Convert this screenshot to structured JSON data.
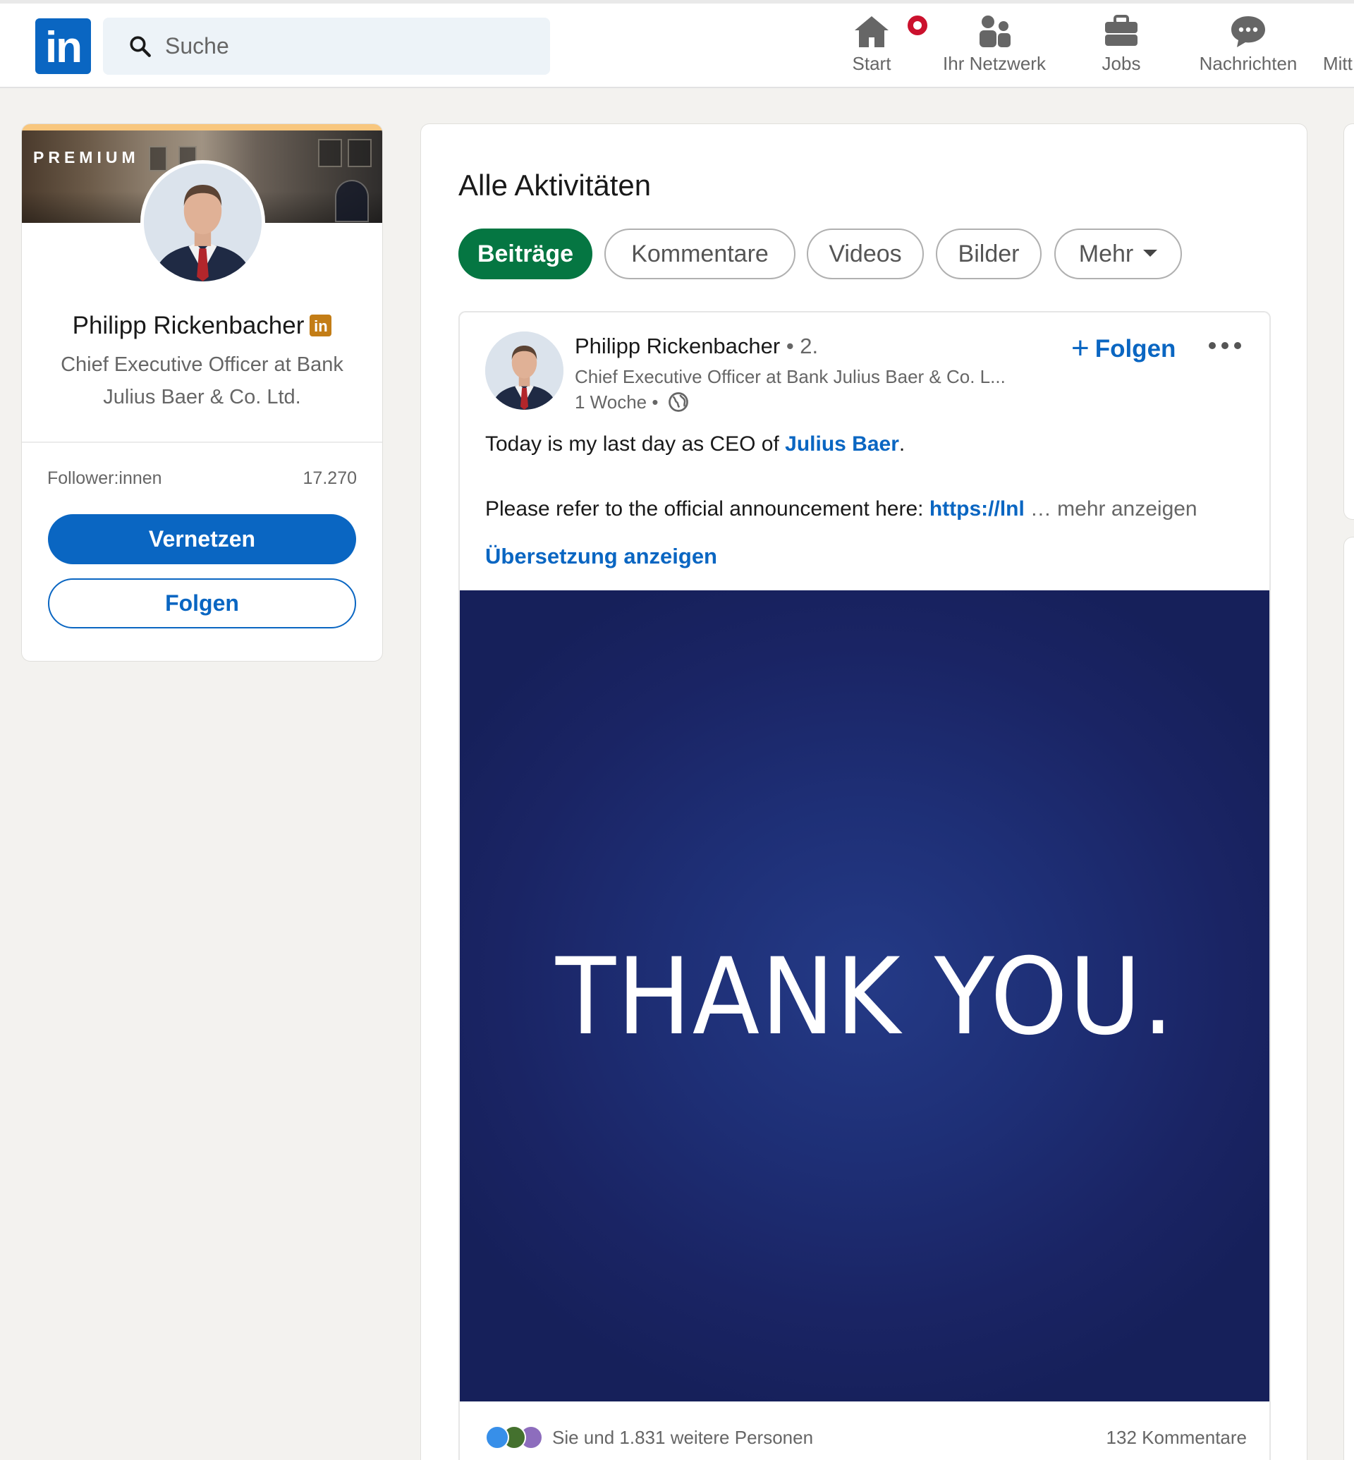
{
  "nav": {
    "logo_text": "in",
    "search_placeholder": "Suche",
    "items": [
      {
        "label": "Start",
        "icon": "home-icon"
      },
      {
        "label": "Ihr Netzwerk",
        "icon": "network-icon"
      },
      {
        "label": "Jobs",
        "icon": "briefcase-icon"
      },
      {
        "label": "Nachrichten",
        "icon": "messages-icon"
      },
      {
        "label": "Mitt",
        "icon": "bell-icon"
      }
    ]
  },
  "profile": {
    "premium_label": "PREMIUM",
    "name": "Philipp Rickenbacher",
    "badge_text": "in",
    "headline": "Chief Executive Officer at Bank Julius Baer & Co. Ltd.",
    "followers_label": "Follower:innen",
    "followers_value": "17.270",
    "connect_label": "Vernetzen",
    "follow_label": "Folgen"
  },
  "activity": {
    "title": "Alle Aktivitäten",
    "tabs": [
      {
        "label": "Beiträge",
        "active": true
      },
      {
        "label": "Kommentare",
        "active": false
      },
      {
        "label": "Videos",
        "active": false
      },
      {
        "label": "Bilder",
        "active": false
      },
      {
        "label": "Mehr",
        "active": false
      }
    ]
  },
  "post": {
    "author_name": "Philipp Rickenbacher",
    "author_degree": "• 2.",
    "author_headline": "Chief Executive Officer at Bank Julius Baer & Co. L...",
    "time": "1 Woche •",
    "follow_plus": "+",
    "follow_label": "Folgen",
    "text_before": "Today is my last day as CEO of ",
    "text_mention": "Julius Baer",
    "text_after": ".",
    "text2_before": "Please refer to the official announcement here: ",
    "text2_link": "https://lnl",
    "text2_more": "… mehr anzeigen",
    "translate": "Übersetzung anzeigen",
    "image_text": "THANK YOU.",
    "reactions_text": "Sie und 1.831 weitere Personen",
    "comments_text": "132 Kommentare"
  },
  "colors": {
    "brand_blue": "#0a66c2",
    "active_tab_green": "#057642",
    "premium_gold": "#f8c77e",
    "notification_red": "#cb112d",
    "image_navy": "#1e2f76"
  }
}
